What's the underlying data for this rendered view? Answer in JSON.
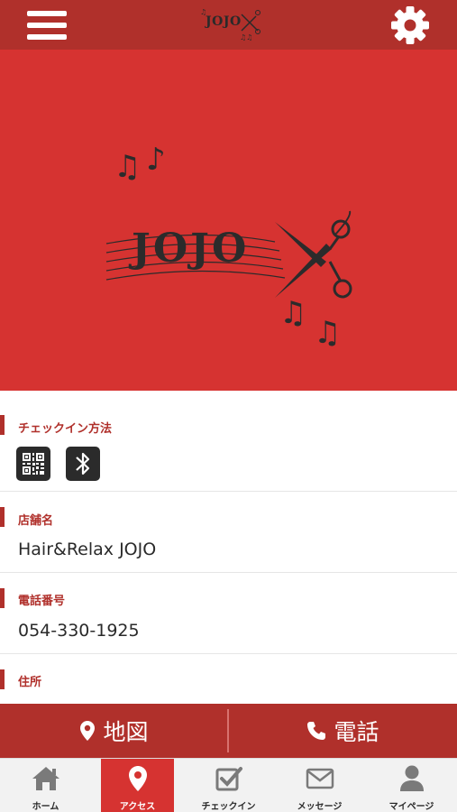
{
  "header": {
    "logo_text": "JOJO"
  },
  "hero": {
    "logo_text": "JOJO"
  },
  "sections": {
    "checkin": {
      "title": "チェックイン方法"
    },
    "shop": {
      "title": "店舗名",
      "value": "Hair&Relax JOJO"
    },
    "phone": {
      "title": "電話番号",
      "value": "054-330-1925"
    },
    "address": {
      "title": "住所"
    }
  },
  "actions": {
    "map_label": "地図",
    "call_label": "電話"
  },
  "tabs": [
    {
      "label": "ホーム",
      "icon": "home-icon",
      "active": false
    },
    {
      "label": "アクセス",
      "icon": "map-pin-icon",
      "active": true
    },
    {
      "label": "チェックイン",
      "icon": "checkbox-icon",
      "active": false
    },
    {
      "label": "メッセージ",
      "icon": "envelope-icon",
      "active": false
    },
    {
      "label": "マイページ",
      "icon": "user-icon",
      "active": false
    }
  ],
  "colors": {
    "brand": "#b0302b",
    "hero": "#d63331",
    "tab_bg": "#f2f2f2"
  }
}
